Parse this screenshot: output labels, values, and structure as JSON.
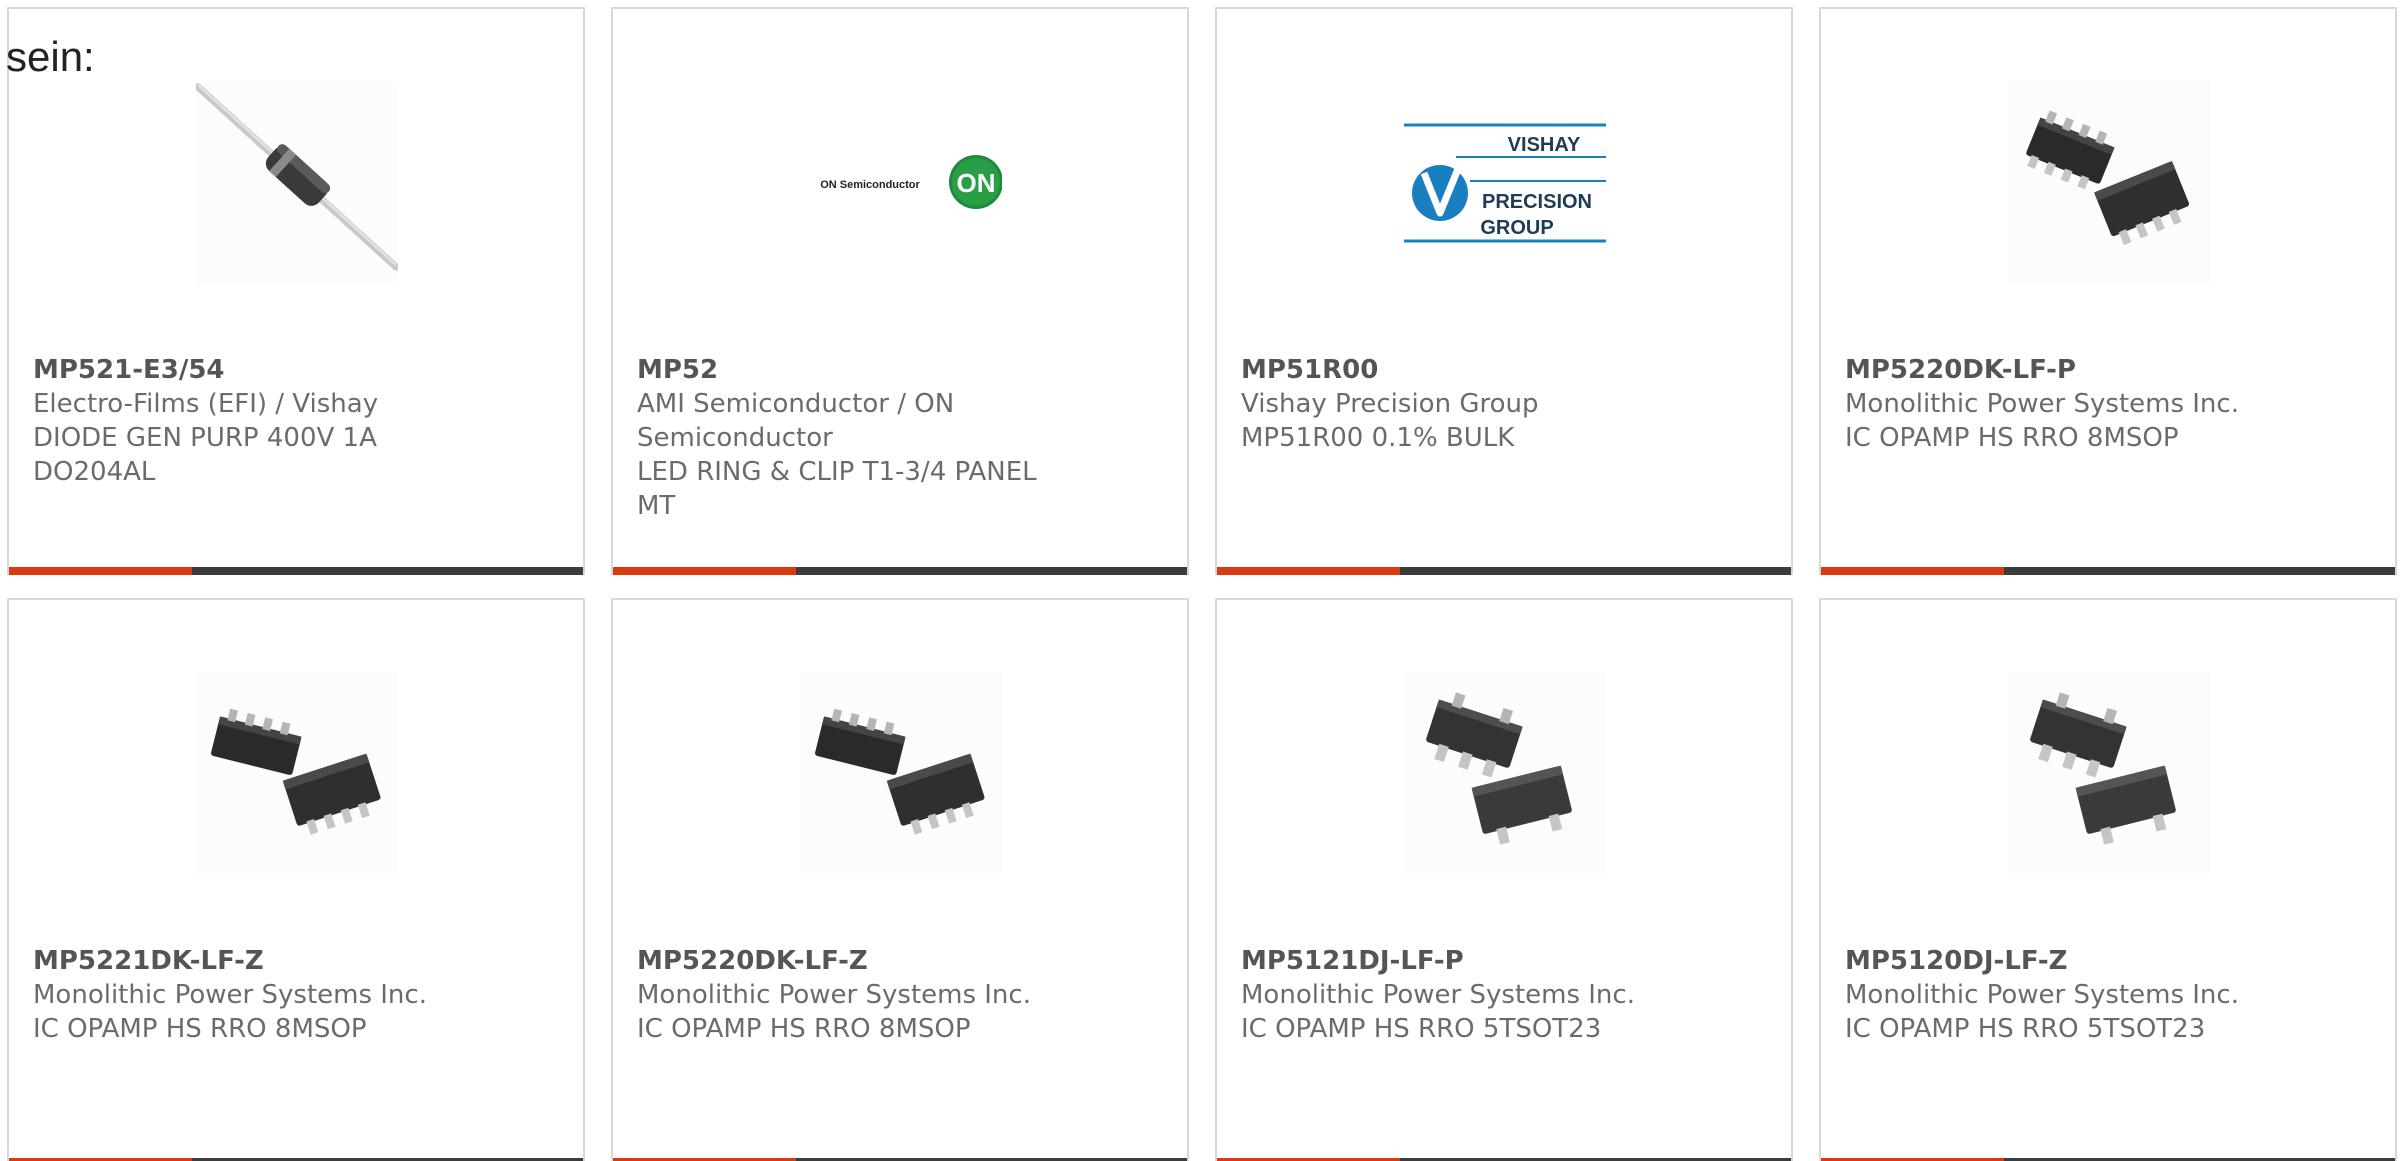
{
  "intro_text": "sein:",
  "colors": {
    "accent": "#d93a10",
    "bar": "#3c3c3c",
    "border": "#d8d8d8",
    "text": "#6b6b6b",
    "part_number": "#555555"
  },
  "products": [
    {
      "part_number": "MP521-E3/54",
      "manufacturer": "Electro-Films (EFI) / Vishay",
      "description": "DIODE GEN PURP 400V 1A DO204AL",
      "image": "axial-diode-image"
    },
    {
      "part_number": "MP52",
      "manufacturer": "AMI Semiconductor / ON Semiconductor",
      "description": "LED RING & CLIP T1-3/4 PANEL MT",
      "image": "on-semiconductor-logo",
      "logo_text": "ON Semiconductor",
      "logo_badge": "ON"
    },
    {
      "part_number": "MP51R00",
      "manufacturer": "Vishay Precision Group",
      "description": "MP51R00 0.1% BULK",
      "image": "vishay-precision-group-logo",
      "logo_lines": [
        "VISHAY",
        "PRECISION",
        "GROUP"
      ]
    },
    {
      "part_number": "MP5220DK-LF-P",
      "manufacturer": "Monolithic Power Systems Inc.",
      "description": "IC OPAMP HS RRO 8MSOP",
      "image": "msop8-chip-image"
    },
    {
      "part_number": "MP5221DK-LF-Z",
      "manufacturer": "Monolithic Power Systems Inc.",
      "description": "IC OPAMP HS RRO 8MSOP",
      "image": "msop8-chip-image"
    },
    {
      "part_number": "MP5220DK-LF-Z",
      "manufacturer": "Monolithic Power Systems Inc.",
      "description": "IC OPAMP HS RRO 8MSOP",
      "image": "msop8-chip-image"
    },
    {
      "part_number": "MP5121DJ-LF-P",
      "manufacturer": "Monolithic Power Systems Inc.",
      "description": "IC OPAMP HS RRO 5TSOT23",
      "image": "tsot23-chip-image"
    },
    {
      "part_number": "MP5120DJ-LF-Z",
      "manufacturer": "Monolithic Power Systems Inc.",
      "description": "IC OPAMP HS RRO 5TSOT23",
      "image": "tsot23-chip-image"
    }
  ]
}
